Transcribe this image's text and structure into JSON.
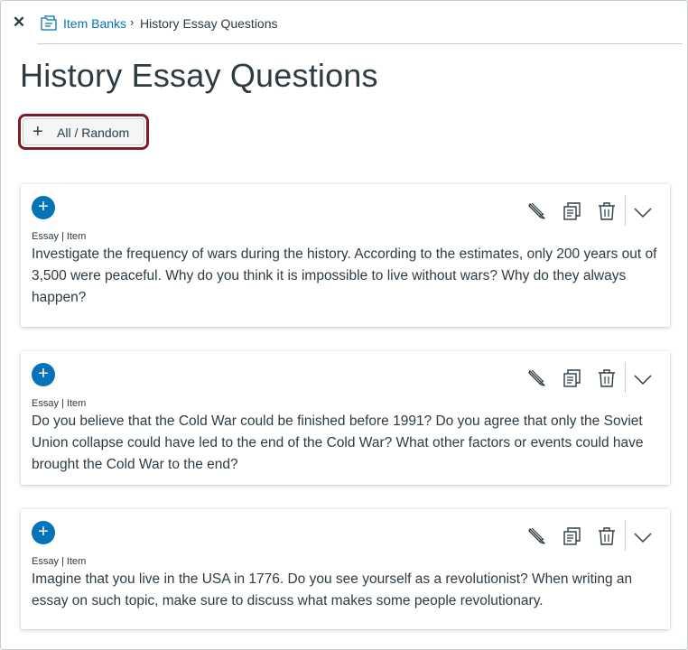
{
  "header": {
    "close_glyph": "✕",
    "breadcrumb": {
      "bank_link": "Item Banks",
      "separator": "›",
      "current": "History Essay Questions"
    }
  },
  "page": {
    "title": "History Essay Questions",
    "add_button_label": "All / Random",
    "add_button_icon": "plus-icon"
  },
  "colors": {
    "link": "#0374b5",
    "focus_ring": "#7e1d24",
    "text": "#2d3b45"
  },
  "items": [
    {
      "meta": "Essay | Item",
      "text": "Investigate the frequency of wars during the history. According to the estimates, only 200 years out of 3,500 were peaceful. Why do you think it is impossible to live without wars? Why do they always happen?"
    },
    {
      "meta": "Essay | Item",
      "text": "Do you believe that the Cold War could be finished before 1991? Do you agree that only the Soviet Union collapse could have led to the end of the Cold War? What other factors or events could have brought the Cold War to the end?"
    },
    {
      "meta": "Essay | Item",
      "text": "Imagine that you live in the USA in 1776. Do you see yourself as a revolutionist? When writing an essay on such topic, make sure to discuss what makes some people revolutionary."
    }
  ],
  "item_actions": [
    "pencil-icon",
    "copy-icon",
    "trash-icon",
    "chevron-down-icon"
  ]
}
